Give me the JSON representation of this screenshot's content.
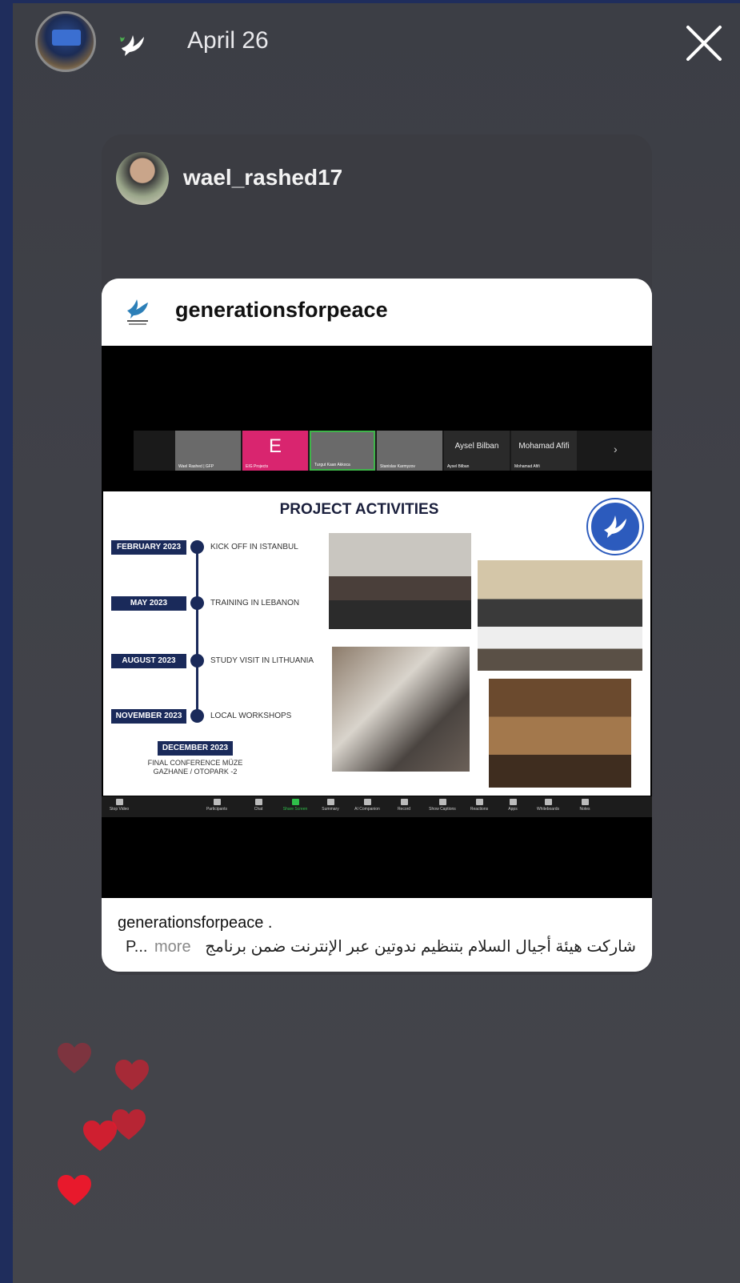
{
  "story": {
    "date": "April 26"
  },
  "shared_post": {
    "username": "wael_rashed17",
    "post": {
      "account": "generationsforpeace",
      "video_strip": {
        "participants": [
          {
            "name": "Wael Rashed | GFP"
          },
          {
            "name": "EIG Projects",
            "letter": "E"
          },
          {
            "name": "Turgut Kaan Akkoca"
          },
          {
            "name": "Stanislav Karmyzov"
          },
          {
            "name": "Aysel Bilban",
            "sub": "Aysel Bilban"
          },
          {
            "name": "Mohamad Afifi",
            "sub": "Mohamad Afifi"
          }
        ]
      },
      "slide": {
        "title": "PROJECT ACTIVITIES",
        "timeline": [
          {
            "date": "FEBRUARY 2023",
            "label": "KICK OFF IN ISTANBUL"
          },
          {
            "date": "MAY 2023",
            "label": "TRAINING IN LEBANON"
          },
          {
            "date": "AUGUST 2023",
            "label": "STUDY VISIT IN LITHUANIA"
          },
          {
            "date": "NOVEMBER 2023",
            "label": "LOCAL WORKSHOPS"
          }
        ],
        "final": {
          "date": "DECEMBER 2023",
          "label": "FINAL CONFERENCE MÜZE GAZHANE / OTOPARK -2"
        }
      },
      "toolbar": [
        {
          "label": "Stop Video"
        },
        {
          "label": "Participants"
        },
        {
          "label": "Chat"
        },
        {
          "label": "Share Screen",
          "highlight": true
        },
        {
          "label": "Summary"
        },
        {
          "label": "AI Companion"
        },
        {
          "label": "Record"
        },
        {
          "label": "Show Captions"
        },
        {
          "label": "Reactions"
        },
        {
          "label": "Apps"
        },
        {
          "label": "Whiteboards"
        },
        {
          "label": "Notes"
        }
      ],
      "caption": {
        "account": "generationsforpeace .",
        "text": "شاركت هيئة أجيال السلام بتنظيم ندوتين عبر الإنترنت ضمن برنامج",
        "more": "more",
        "ellipsis": "P..."
      }
    }
  },
  "colors": {
    "background": "#1f2d5c",
    "story_bg": "#404148",
    "heart": "#e8192c",
    "zoom_green": "#2fbf4a"
  }
}
